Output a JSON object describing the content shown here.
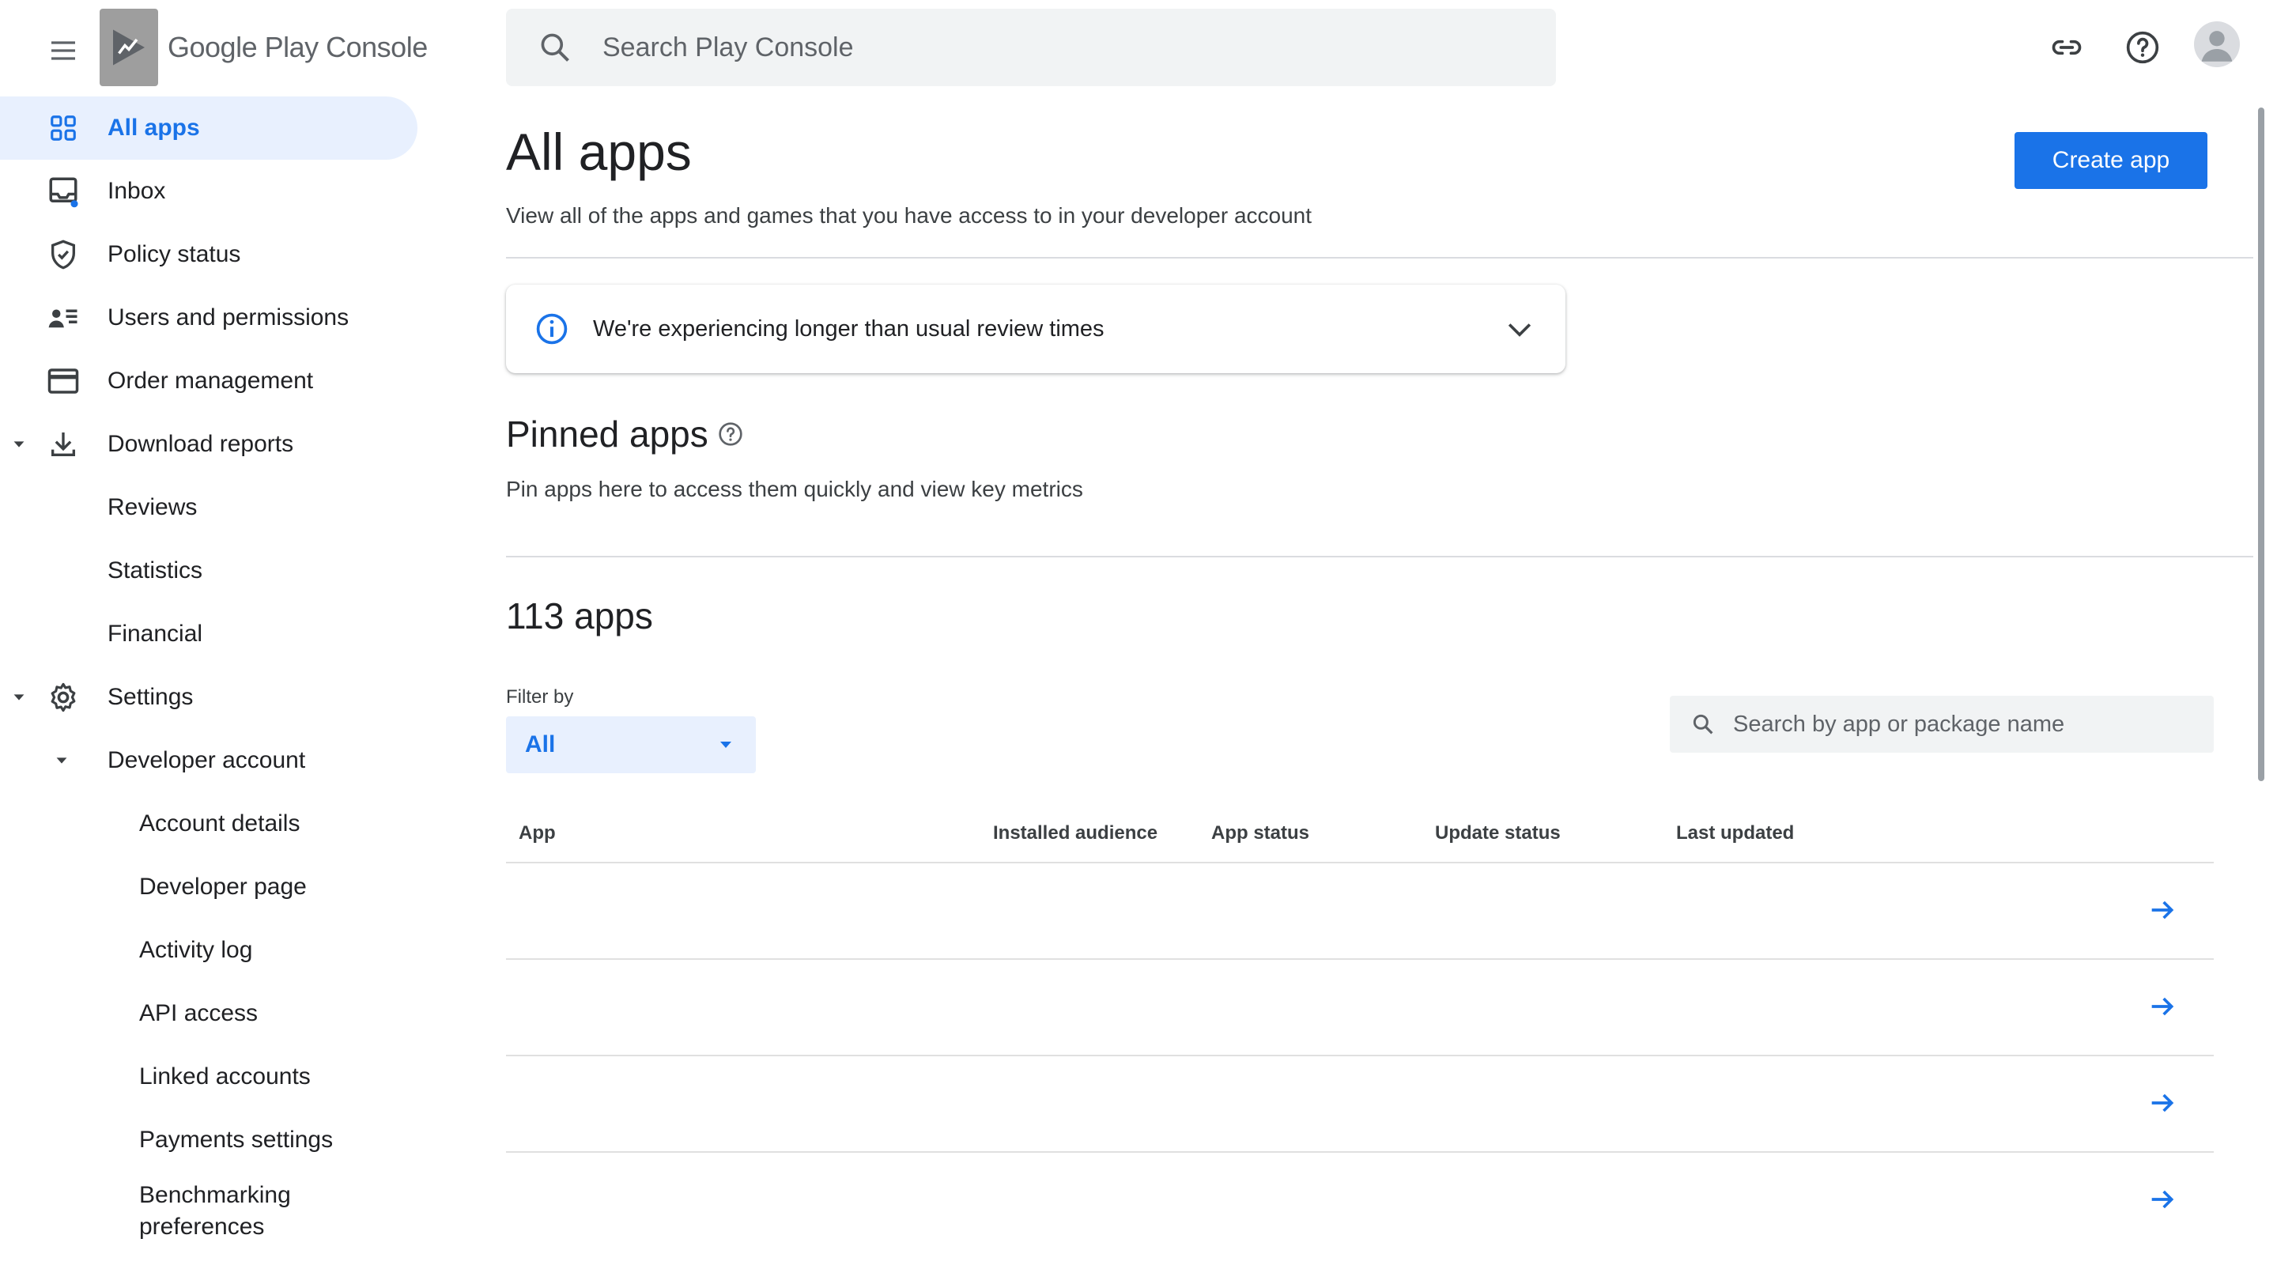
{
  "app": {
    "brand_primary": "Google Play",
    "brand_secondary": "Console",
    "accent_color": "#1a73e8"
  },
  "topbar": {
    "search_placeholder": "Search Play Console",
    "icons": [
      "menu-icon",
      "link-icon",
      "help-icon",
      "account-avatar"
    ]
  },
  "sidebar": {
    "items": [
      {
        "label": "All apps",
        "icon": "grid-icon",
        "active": true
      },
      {
        "label": "Inbox",
        "icon": "inbox-icon",
        "badge_dot": true
      },
      {
        "label": "Policy status",
        "icon": "shield-icon"
      },
      {
        "label": "Users and permissions",
        "icon": "users-icon"
      },
      {
        "label": "Order management",
        "icon": "credit-card-icon"
      },
      {
        "label": "Download reports",
        "icon": "download-icon",
        "expanded": true
      },
      {
        "label": "Reviews"
      },
      {
        "label": "Statistics"
      },
      {
        "label": "Financial"
      },
      {
        "label": "Settings",
        "icon": "gear-icon",
        "expanded": true
      },
      {
        "label": "Developer account",
        "expanded": true
      },
      {
        "label": "Account details"
      },
      {
        "label": "Developer page"
      },
      {
        "label": "Activity log"
      },
      {
        "label": "API access"
      },
      {
        "label": "Linked accounts"
      },
      {
        "label": "Payments settings"
      },
      {
        "label": "Benchmarking preferences"
      }
    ]
  },
  "main": {
    "title": "All apps",
    "subtitle": "View all of the apps and games that you have access to in your developer account",
    "create_button": "Create app",
    "notice": "We're experiencing longer than usual review times",
    "pinned": {
      "title": "Pinned apps",
      "subtitle": "Pin apps here to access them quickly and view key metrics"
    },
    "apps_count": "113 apps",
    "filter": {
      "label": "Filter by",
      "value": "All"
    },
    "app_search_placeholder": "Search by app or package name",
    "table": {
      "columns": [
        "App",
        "Installed audience",
        "App status",
        "Update status",
        "Last updated"
      ],
      "row_count_visible": 4
    }
  }
}
